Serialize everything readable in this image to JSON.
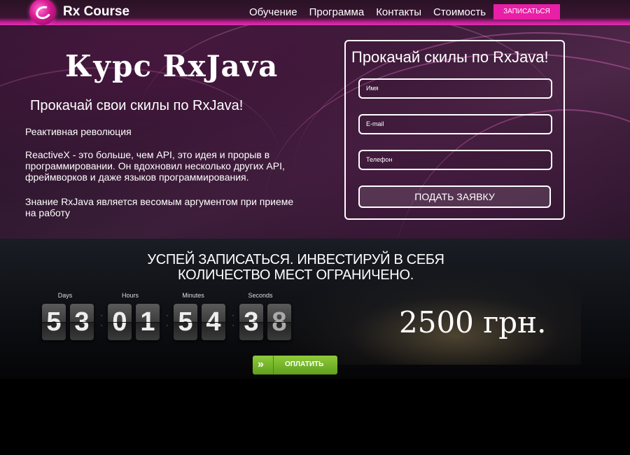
{
  "header": {
    "logo_text": "Rx Course",
    "nav": [
      "Обучение",
      "Программа",
      "Контакты",
      "Стоимость"
    ],
    "signup_label": "ЗАПИСАТЬСЯ",
    "accent_color": "#e91fa7"
  },
  "hero": {
    "title": "Курс RxJava",
    "subtitle": "Прокачай свои скилы по RxJava!",
    "paragraphs": [
      "Реактивная революция",
      "ReactiveX - это больше, чем API, это идея и прорыв в программировании. Он вдохновил несколько других API, фреймворков и даже языков программирования.",
      "Знание RxJava является весомым аргументом при приеме на работу"
    ]
  },
  "form": {
    "title": "Прокачай скилы по RxJava!",
    "name_placeholder": "Имя",
    "email_placeholder": "E-mail",
    "phone_placeholder": "Телефон",
    "submit_label": "ПОДАТЬ ЗАЯВКУ"
  },
  "countdown": {
    "heading_line1": "УСПЕЙ ЗАПИСАТЬСЯ. ИНВЕСТИРУЙ В СЕБЯ",
    "heading_line2": "КОЛИЧЕСТВО МЕСТ ОГРАНИЧЕНО.",
    "labels": [
      "Days",
      "Hours",
      "Minutes",
      "Seconds"
    ],
    "digits": [
      "5",
      "3",
      "0",
      "1",
      "5",
      "4",
      "3",
      "8"
    ],
    "price": "2500 грн.",
    "pay_icon": "double-chevron-right-icon",
    "pay_label": "ОПЛАТИТЬ",
    "pay_color": "#7cbb2e"
  }
}
